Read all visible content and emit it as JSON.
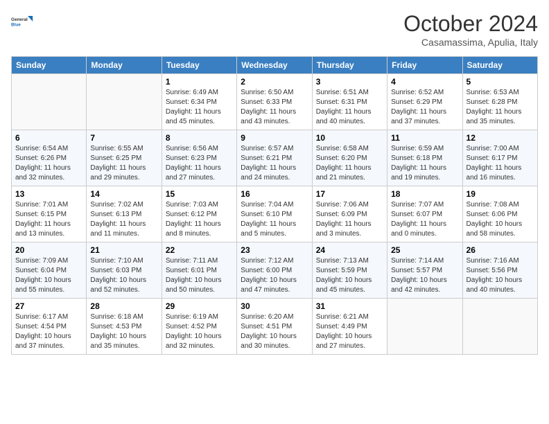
{
  "header": {
    "logo_line1": "General",
    "logo_line2": "Blue",
    "month_title": "October 2024",
    "subtitle": "Casamassima, Apulia, Italy"
  },
  "weekdays": [
    "Sunday",
    "Monday",
    "Tuesday",
    "Wednesday",
    "Thursday",
    "Friday",
    "Saturday"
  ],
  "weeks": [
    [
      {
        "day": "",
        "info": ""
      },
      {
        "day": "",
        "info": ""
      },
      {
        "day": "1",
        "info": "Sunrise: 6:49 AM\nSunset: 6:34 PM\nDaylight: 11 hours and 45 minutes."
      },
      {
        "day": "2",
        "info": "Sunrise: 6:50 AM\nSunset: 6:33 PM\nDaylight: 11 hours and 43 minutes."
      },
      {
        "day": "3",
        "info": "Sunrise: 6:51 AM\nSunset: 6:31 PM\nDaylight: 11 hours and 40 minutes."
      },
      {
        "day": "4",
        "info": "Sunrise: 6:52 AM\nSunset: 6:29 PM\nDaylight: 11 hours and 37 minutes."
      },
      {
        "day": "5",
        "info": "Sunrise: 6:53 AM\nSunset: 6:28 PM\nDaylight: 11 hours and 35 minutes."
      }
    ],
    [
      {
        "day": "6",
        "info": "Sunrise: 6:54 AM\nSunset: 6:26 PM\nDaylight: 11 hours and 32 minutes."
      },
      {
        "day": "7",
        "info": "Sunrise: 6:55 AM\nSunset: 6:25 PM\nDaylight: 11 hours and 29 minutes."
      },
      {
        "day": "8",
        "info": "Sunrise: 6:56 AM\nSunset: 6:23 PM\nDaylight: 11 hours and 27 minutes."
      },
      {
        "day": "9",
        "info": "Sunrise: 6:57 AM\nSunset: 6:21 PM\nDaylight: 11 hours and 24 minutes."
      },
      {
        "day": "10",
        "info": "Sunrise: 6:58 AM\nSunset: 6:20 PM\nDaylight: 11 hours and 21 minutes."
      },
      {
        "day": "11",
        "info": "Sunrise: 6:59 AM\nSunset: 6:18 PM\nDaylight: 11 hours and 19 minutes."
      },
      {
        "day": "12",
        "info": "Sunrise: 7:00 AM\nSunset: 6:17 PM\nDaylight: 11 hours and 16 minutes."
      }
    ],
    [
      {
        "day": "13",
        "info": "Sunrise: 7:01 AM\nSunset: 6:15 PM\nDaylight: 11 hours and 13 minutes."
      },
      {
        "day": "14",
        "info": "Sunrise: 7:02 AM\nSunset: 6:13 PM\nDaylight: 11 hours and 11 minutes."
      },
      {
        "day": "15",
        "info": "Sunrise: 7:03 AM\nSunset: 6:12 PM\nDaylight: 11 hours and 8 minutes."
      },
      {
        "day": "16",
        "info": "Sunrise: 7:04 AM\nSunset: 6:10 PM\nDaylight: 11 hours and 5 minutes."
      },
      {
        "day": "17",
        "info": "Sunrise: 7:06 AM\nSunset: 6:09 PM\nDaylight: 11 hours and 3 minutes."
      },
      {
        "day": "18",
        "info": "Sunrise: 7:07 AM\nSunset: 6:07 PM\nDaylight: 11 hours and 0 minutes."
      },
      {
        "day": "19",
        "info": "Sunrise: 7:08 AM\nSunset: 6:06 PM\nDaylight: 10 hours and 58 minutes."
      }
    ],
    [
      {
        "day": "20",
        "info": "Sunrise: 7:09 AM\nSunset: 6:04 PM\nDaylight: 10 hours and 55 minutes."
      },
      {
        "day": "21",
        "info": "Sunrise: 7:10 AM\nSunset: 6:03 PM\nDaylight: 10 hours and 52 minutes."
      },
      {
        "day": "22",
        "info": "Sunrise: 7:11 AM\nSunset: 6:01 PM\nDaylight: 10 hours and 50 minutes."
      },
      {
        "day": "23",
        "info": "Sunrise: 7:12 AM\nSunset: 6:00 PM\nDaylight: 10 hours and 47 minutes."
      },
      {
        "day": "24",
        "info": "Sunrise: 7:13 AM\nSunset: 5:59 PM\nDaylight: 10 hours and 45 minutes."
      },
      {
        "day": "25",
        "info": "Sunrise: 7:14 AM\nSunset: 5:57 PM\nDaylight: 10 hours and 42 minutes."
      },
      {
        "day": "26",
        "info": "Sunrise: 7:16 AM\nSunset: 5:56 PM\nDaylight: 10 hours and 40 minutes."
      }
    ],
    [
      {
        "day": "27",
        "info": "Sunrise: 6:17 AM\nSunset: 4:54 PM\nDaylight: 10 hours and 37 minutes."
      },
      {
        "day": "28",
        "info": "Sunrise: 6:18 AM\nSunset: 4:53 PM\nDaylight: 10 hours and 35 minutes."
      },
      {
        "day": "29",
        "info": "Sunrise: 6:19 AM\nSunset: 4:52 PM\nDaylight: 10 hours and 32 minutes."
      },
      {
        "day": "30",
        "info": "Sunrise: 6:20 AM\nSunset: 4:51 PM\nDaylight: 10 hours and 30 minutes."
      },
      {
        "day": "31",
        "info": "Sunrise: 6:21 AM\nSunset: 4:49 PM\nDaylight: 10 hours and 27 minutes."
      },
      {
        "day": "",
        "info": ""
      },
      {
        "day": "",
        "info": ""
      }
    ]
  ]
}
